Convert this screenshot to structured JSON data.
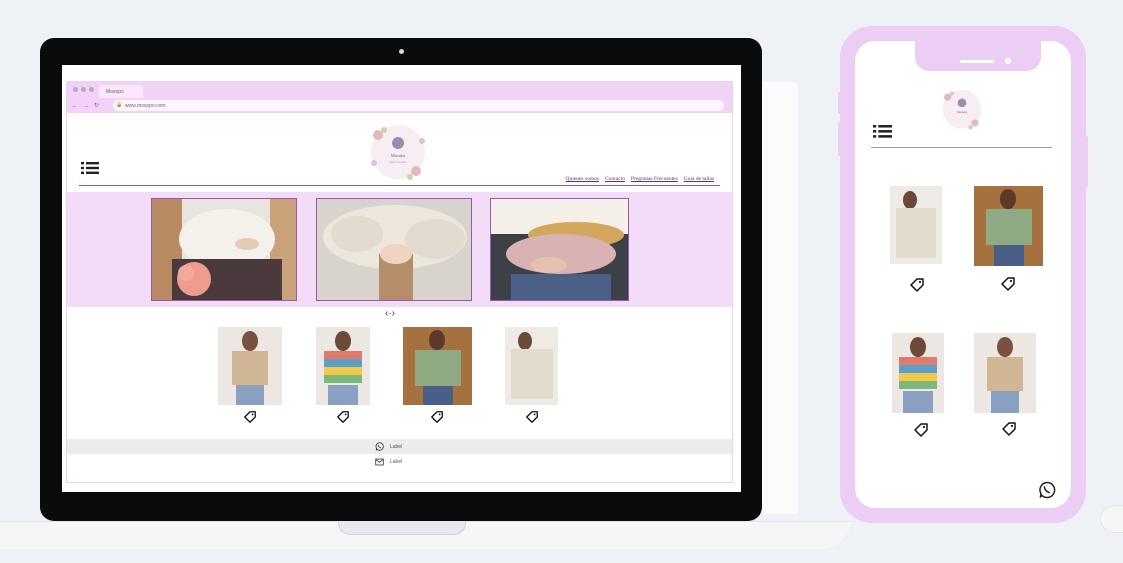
{
  "browser": {
    "tab_title": "Mosopo",
    "url": "www.mosopo.com",
    "nav_icons": [
      "back-arrow-icon",
      "forward-arrow-icon",
      "reload-icon",
      "lock-icon"
    ]
  },
  "site": {
    "logo_text": "Mosuka",
    "logo_subtext": "tejidos con amor",
    "nav_links": [
      "Quienes somos",
      "Contacto",
      "Preguntas Frecuentes",
      "Guia de tallas"
    ]
  },
  "carousel": {
    "control_label": "‹·›"
  },
  "footer": {
    "whatsapp_label": "Label",
    "email_label": "Label"
  },
  "colors": {
    "accent": "#f2d2f7",
    "hero_bg": "#f3dcf7",
    "border": "#9c58a8",
    "phone_frame": "#eccdf3",
    "laptop_frame": "#0b0b0b"
  },
  "icons": [
    "list-menu-icon",
    "price-tag-icon",
    "whatsapp-icon",
    "mail-icon"
  ]
}
